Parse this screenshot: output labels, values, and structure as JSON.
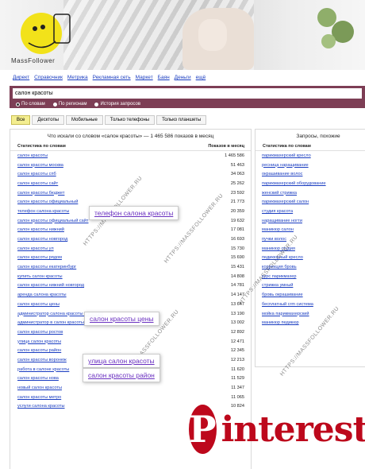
{
  "banner": {
    "brand": "MassFollower"
  },
  "nav": [
    "Директ",
    "Справочник",
    "Метрика",
    "Рекламная сеть",
    "Маркет",
    "Баян",
    "Деньги",
    "ещё"
  ],
  "search": {
    "value": "салон красоты"
  },
  "scope": {
    "options": [
      "По словам",
      "По регионам",
      "История запросов"
    ],
    "selected": 0
  },
  "tabs": [
    "Все",
    "Десктопы",
    "Мобильные",
    "Только телефоны",
    "Только планшеты"
  ],
  "main": {
    "title": "Что искали со словом «салон красоты» — 1 465 586 показов в месяц",
    "col_query": "Статистика по словам",
    "col_count": "Показов в месяц",
    "rows": [
      [
        "салон красоты",
        "1 465 586"
      ],
      [
        "салон красоты москва",
        "51 463"
      ],
      [
        "салон красоты спб",
        "34 063"
      ],
      [
        "салон красоты сайт",
        "25 262"
      ],
      [
        "салон красоты бюджет",
        "23 592"
      ],
      [
        "салон красоты официальный",
        "21 773"
      ],
      [
        "телефон салона красоты",
        "20 359"
      ],
      [
        "салон красоты официальный сайт",
        "19 632"
      ],
      [
        "салон красоты нижний",
        "17 081"
      ],
      [
        "салон красоты новгород",
        "16 693"
      ],
      [
        "салон красоты ул",
        "15 730"
      ],
      [
        "салон красоты рядом",
        "15 690"
      ],
      [
        "салон красоты екатеринбург",
        "15 431"
      ],
      [
        "купить салон красоты",
        "14 808"
      ],
      [
        "салон красоты нижний новгород",
        "14 781"
      ],
      [
        "аренда салона красоты",
        "14 147"
      ],
      [
        "салон красоты цены",
        "13 647"
      ],
      [
        "администратор салона красоты вакансии",
        "13 190"
      ],
      [
        "администратор в салон красоты",
        "13 002"
      ],
      [
        "салон красоты ростов",
        "12 892"
      ],
      [
        "улица салон красоты",
        "12 471"
      ],
      [
        "салон красоты район",
        "12 345"
      ],
      [
        "салон красоты воронеж",
        "12 213"
      ],
      [
        "работа в салоне красоты",
        "11 620"
      ],
      [
        "салон красоты нова",
        "11 529"
      ],
      [
        "новый салон красоты",
        "11 347"
      ],
      [
        "салон красоты метро",
        "11 065"
      ],
      [
        "услуги салона красоты",
        "10 824"
      ]
    ]
  },
  "side": {
    "title": "Запросы, похожие",
    "col_query": "Статистика по словам",
    "rows": [
      "парикмахерский кресло",
      "ресница наращивание",
      "окрашивание волос",
      "парикмахерский оборудование",
      "женский стрижка",
      "парикмахерский салон",
      "студия красота",
      "наращивание ногти",
      "маникюр салон",
      "пучки волос",
      "маникюр студия",
      "педикюрный кресло",
      "коррекция бровь",
      "курс парикмахер",
      "стрижка умный",
      "бровь окрашивание",
      "бесплатный crm система",
      "мойка парикмахерский",
      "маникюр педикюр"
    ]
  },
  "callouts": [
    "телефон салона красоты",
    "салон красоты цены",
    "улица салон красоты",
    "салон красоты район"
  ],
  "watermark": "HTTPS://MASSFOLLOWER.RU",
  "pinterest": {
    "letter": "P",
    "word": "interest"
  }
}
